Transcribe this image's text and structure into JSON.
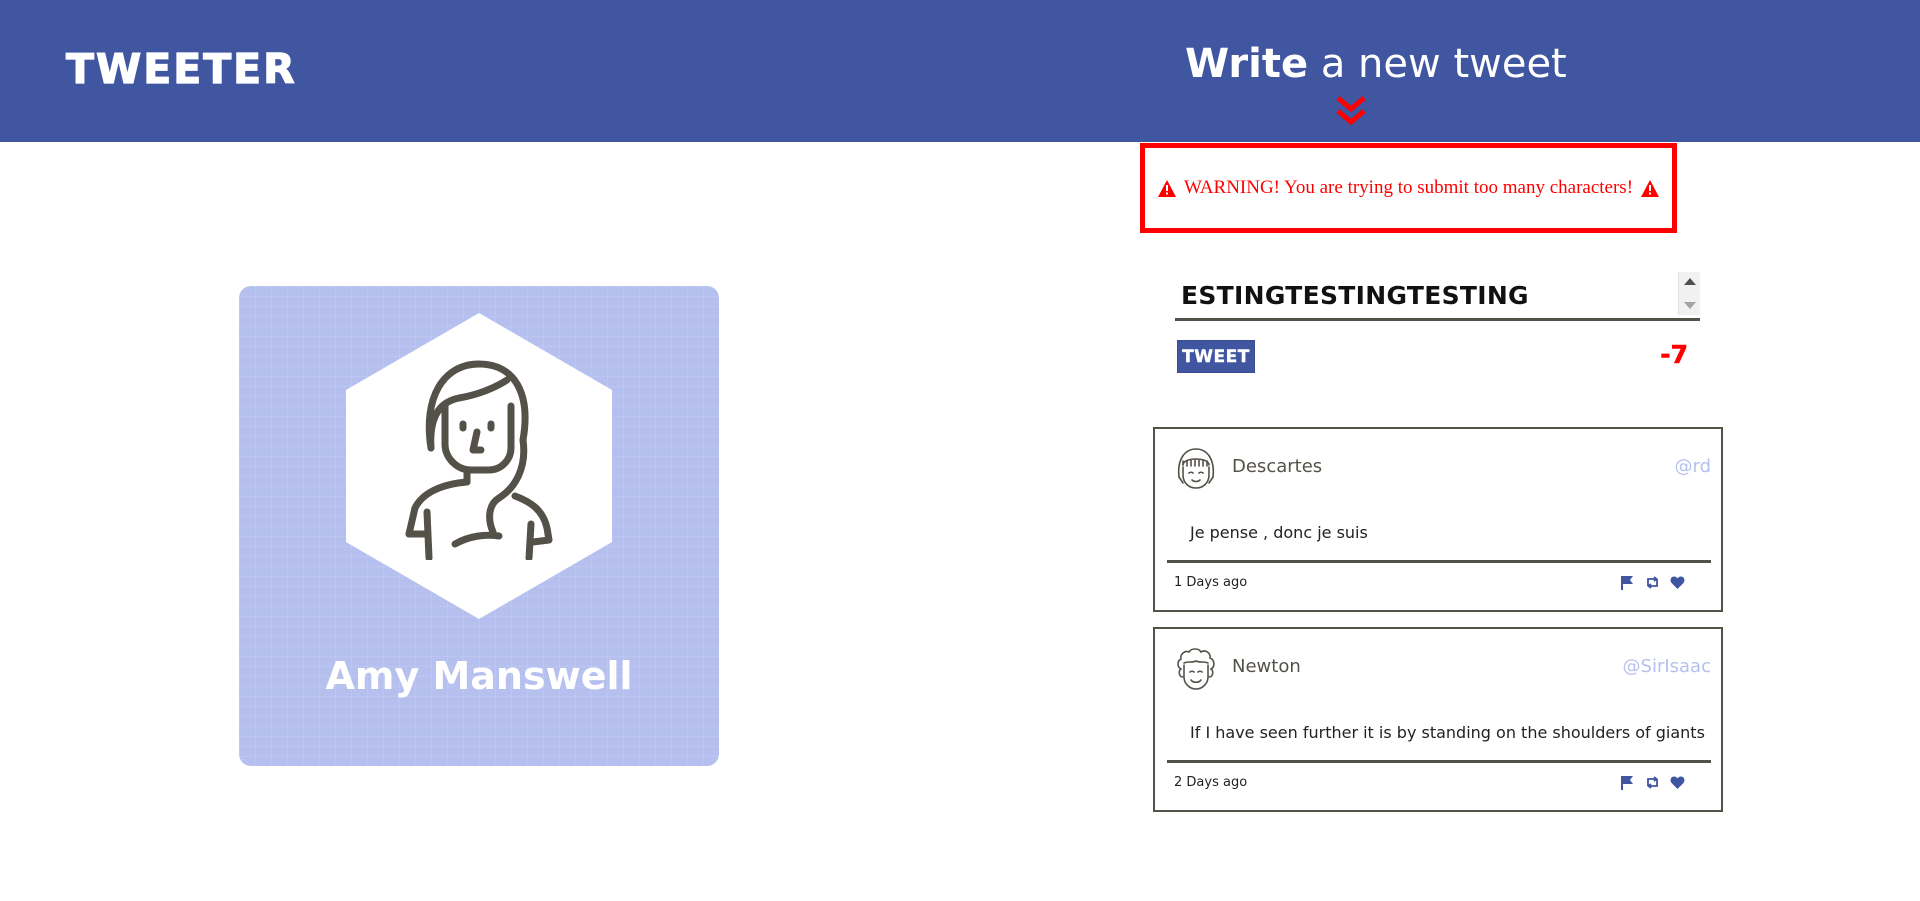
{
  "app": {
    "brand": "TWEETER",
    "colors": {
      "primary": "#4056a1",
      "profile_bg": "#b6c0ee",
      "warning": "#ff0000",
      "text_dark": "#545149",
      "handle": "#b6c0ee"
    }
  },
  "nav": {
    "compose_title_strong": "Write",
    "compose_title_rest": " a new tweet",
    "compose_toggle_icon": "double-chevron-down-icon"
  },
  "profile": {
    "name": "Amy Manswell",
    "avatar_icon": "woman-avatar-icon"
  },
  "warning": {
    "icon": "warning-triangle-icon",
    "message": "WARNING! You are trying to submit too many characters!"
  },
  "new_tweet": {
    "text_value": "ESTINGTESTINGTESTING",
    "submit_label": "TWEET",
    "counter": "-7"
  },
  "tweets": [
    {
      "user": "Descartes",
      "handle": "@rd",
      "avatar_icon": "bangs-face-avatar-icon",
      "content": "Je pense , donc je suis",
      "time": "1 Days ago",
      "actions": [
        "flag-icon",
        "retweet-icon",
        "heart-icon"
      ]
    },
    {
      "user": "Newton",
      "handle": "@SirIsaac",
      "avatar_icon": "curly-hair-face-avatar-icon",
      "content": "If I have seen further it is by standing on the shoulders of giants",
      "time": "2 Days ago",
      "actions": [
        "flag-icon",
        "retweet-icon",
        "heart-icon"
      ]
    }
  ]
}
